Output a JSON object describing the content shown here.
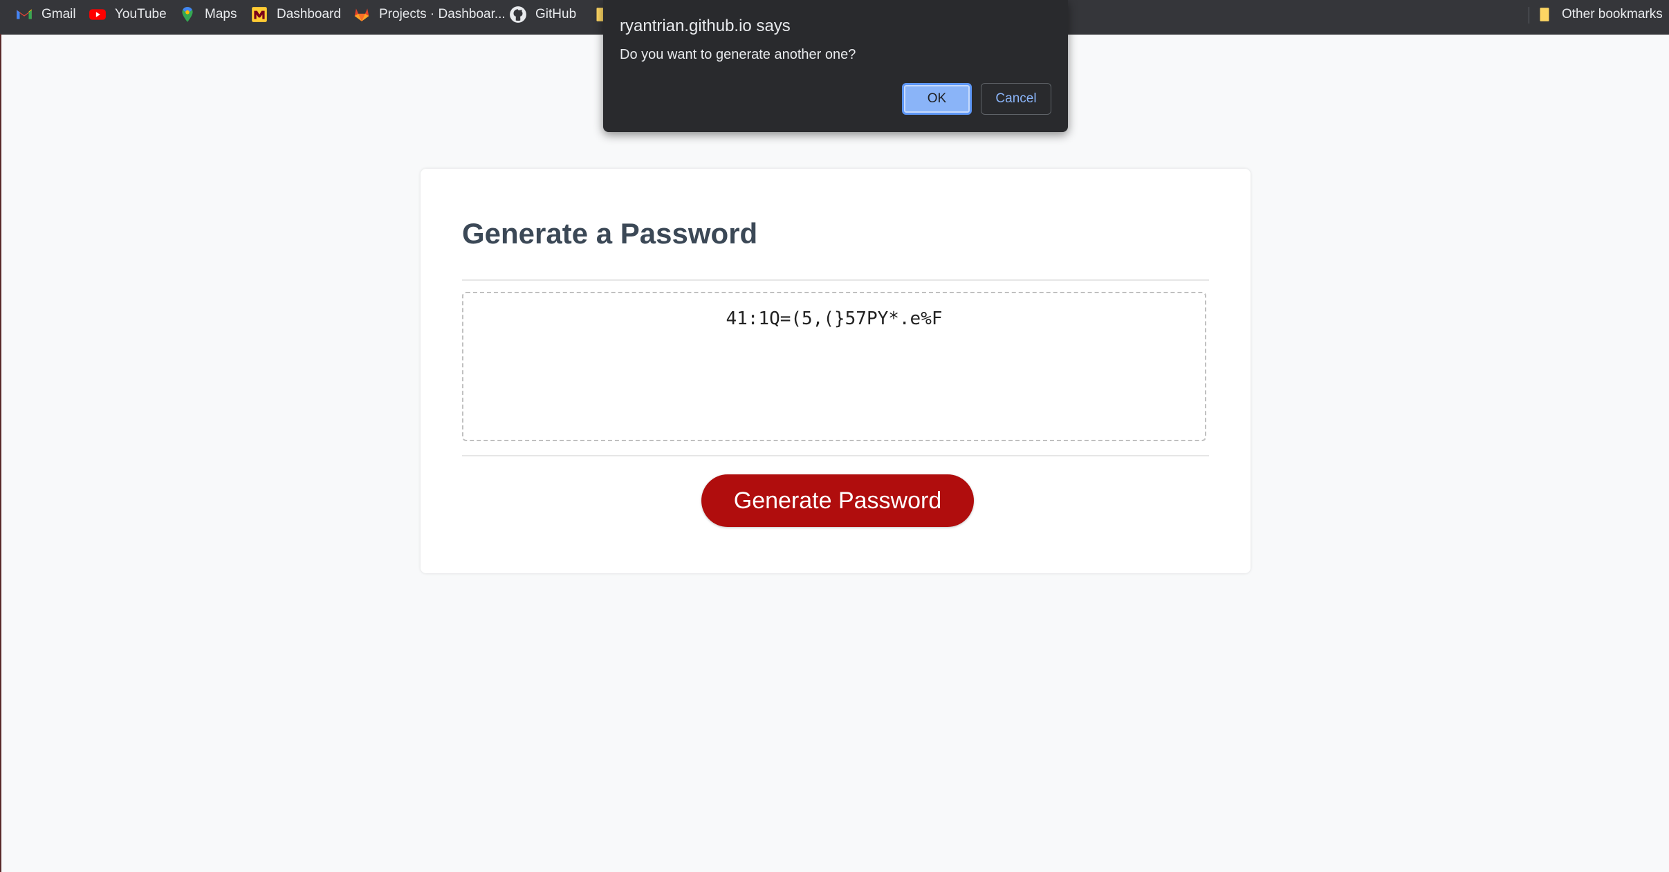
{
  "bookmarks": {
    "items": [
      {
        "label": "Gmail",
        "icon": "gmail-icon"
      },
      {
        "label": "YouTube",
        "icon": "youtube-icon"
      },
      {
        "label": "Maps",
        "icon": "maps-icon"
      },
      {
        "label": "Dashboard",
        "icon": "dashboard-icon"
      },
      {
        "label": "Projects · Dashboar...",
        "icon": "gitlab-icon"
      },
      {
        "label": "GitHub",
        "icon": "github-icon"
      },
      {
        "label": "",
        "icon": "folder-icon"
      }
    ],
    "other_bookmarks": "Other bookmarks"
  },
  "dialog": {
    "origin": "ryantrian.github.io says",
    "message": "Do you want to generate another one?",
    "ok_label": "OK",
    "cancel_label": "Cancel"
  },
  "card": {
    "title": "Generate a Password",
    "password": "41:1Q=(5,(}57PY*.e%F",
    "button_label": "Generate Password"
  },
  "colors": {
    "accent": "#b00d0d",
    "title": "#3b4856",
    "dialog_bg": "#292a2d",
    "dialog_ok": "#8ab4f8"
  }
}
